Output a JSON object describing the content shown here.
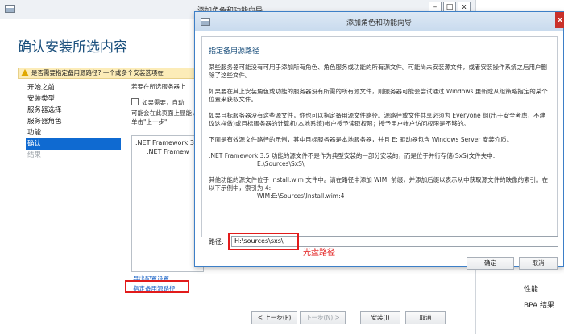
{
  "back_window": {
    "title": "添加角色和功能向导",
    "heading": "确认安装所选内容",
    "warning": "是否需要指定备用源路径? 一个或多个安装选项在",
    "nav": [
      "开始之前",
      "安装类型",
      "服务器选择",
      "服务器角色",
      "功能",
      "确认",
      "结果"
    ],
    "center_text_1": "若要在所选服务器上",
    "checkbox_label": "如果需要，自动",
    "center_text_2": "可能会在此页面上显能，请单击\"上一步\"",
    "list_items": [
      ".NET Framework 3",
      ".NET Framew"
    ],
    "link_export": "导出配置设置",
    "link_alt_source": "指定备用源路径",
    "buttons": {
      "prev": "< 上一步(P)",
      "next": "下一步(N) >",
      "install": "安装(I)",
      "cancel": "取消"
    },
    "right_panel": [
      "性能",
      "BPA 结果"
    ]
  },
  "dialog": {
    "title": "添加角色和功能向导",
    "heading": "指定备用源路径",
    "para1": "某些服务器可能没有可用于添加所有角色、角色服务或功能的所有源文件。可能尚未安装源文件，或者安装操作系统之后用户删除了这些文件。",
    "para2": "如果要在其上安装角色或功能的服务器没有所需的所有源文件，则服务器可能会尝试通过 Windows 更新或从组策略指定的某个位置来获取文件。",
    "para3": "如果目标服务器没有这些源文件，你也可以指定备用源文件路径。源路径或文件共享必须为 Everyone 组(出于安全考虑，不建议这样做)或目标服务器的计算机(本地系统)帐户授予读取权限；授予用户帐户访问权限是不够的。",
    "para4": "下面是有效源文件路径的示例，其中目标服务器是本地服务器，并且 E: 驱动器包含 Windows Server 安装介质。",
    "para5": ".NET Framework 3.5 功能的源文件不是作为典型安装的一部分安装的，而是位于并行存储(SxS)文件夹中:",
    "para5_path": "E:\\Sources\\SxS\\",
    "para6": "其他功能的源文件位于 Install.wim 文件中。请在路径中添加 WIM: 前缀，并添加后缀以表示从中获取源文件的映像的索引。在以下示例中，索引为 4:",
    "para6_path": "WIM:E:\\Sources\\Install.wim:4",
    "path_label": "路径:",
    "path_value": "H:\\sources\\sxs\\",
    "annotation": "光盘路径",
    "ok": "确定",
    "cancel": "取消",
    "close": "x"
  },
  "colors": {
    "accent": "#0f6ad1",
    "annotation_red": "#e21b1b",
    "heading_blue": "#1a4f7c"
  }
}
